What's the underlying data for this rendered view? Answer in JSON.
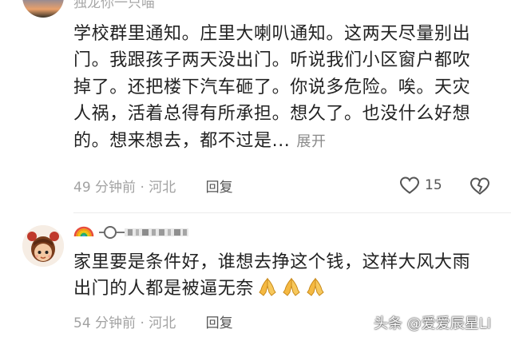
{
  "comments": [
    {
      "username": "独龙你一只喵",
      "lines": [
        "学校群里通知。庄里大喇叭通知。这两天尽量别出",
        "门。我跟孩子两天没出门。听说我们小区窗户都吹",
        "掉了。还把楼下汽车砸了。你说多危险。唉。天灾",
        "人祸，活着总得有所承担。想久了。也没什么好想",
        "的。想来想去，都不过是..."
      ],
      "expand_label": "展开",
      "time": "49 分钟前",
      "location": "河北",
      "separator": "·",
      "reply_label": "回复",
      "like_count": "15",
      "icons": [
        "heart-icon",
        "broken-heart-icon"
      ]
    },
    {
      "username_badge": "rainbow-emoji",
      "lines": [
        "家里要是条件好，谁想去挣这个钱，这样大风大雨",
        "出门的人都是被逼无奈"
      ],
      "emoji": [
        "praying-hands-emoji",
        "praying-hands-emoji",
        "praying-hands-emoji"
      ],
      "time": "54 分钟前",
      "location": "河北",
      "separator": "·",
      "reply_label": "回复"
    }
  ],
  "watermark": "头条 @爱爱辰星LI",
  "colors": {
    "text": "#222222",
    "meta": "#a2a2a2",
    "reply": "#555555",
    "expand": "#8a8a8a",
    "divider": "#ececec"
  }
}
